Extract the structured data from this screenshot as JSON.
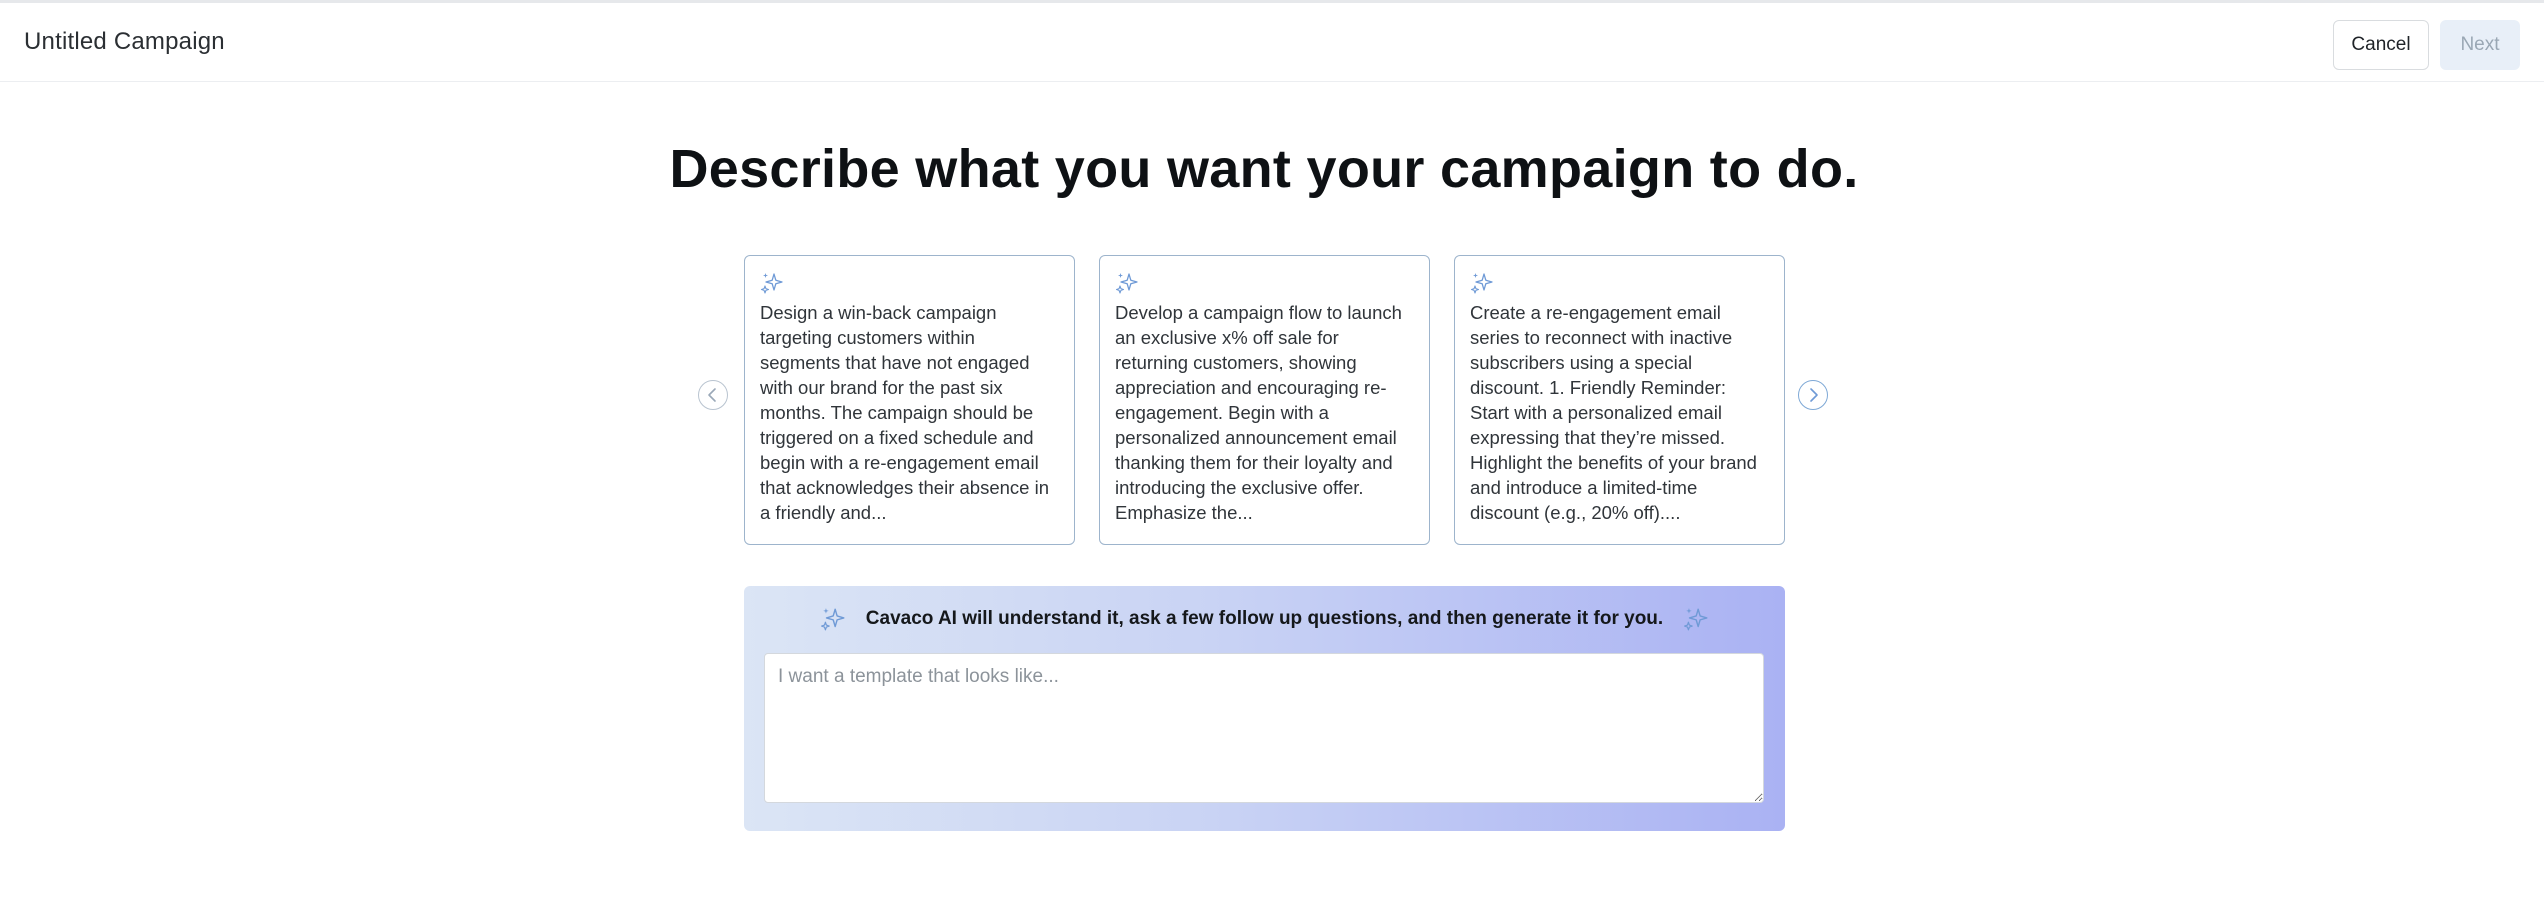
{
  "header": {
    "title": "Untitled Campaign",
    "cancel_label": "Cancel",
    "next_label": "Next"
  },
  "main": {
    "headline": "Describe what you want your campaign to do.",
    "suggestions": [
      {
        "text": "Design a win-back campaign targeting customers within segments that have not engaged with our brand for the past six months. The campaign should be triggered on a fixed schedule and begin with a re-engagement email that acknowledges their absence in a friendly and..."
      },
      {
        "text": "Develop a campaign flow to launch an exclusive x% off sale for returning customers, showing appreciation and encouraging re-engagement. Begin with a personalized announcement email thanking them for their loyalty and introducing the exclusive offer. Emphasize the..."
      },
      {
        "text": "Create a re-engagement email series to reconnect with inactive subscribers using a special discount. 1. Friendly Reminder: Start with a personalized email expressing that they’re missed. Highlight the benefits of your brand and introduce a limited-time discount (e.g., 20% off)...."
      }
    ],
    "ai_banner": "Cavaco AI will understand it, ask a few follow up questions, and then generate it for you.",
    "prompt": {
      "value": "",
      "placeholder": "I want a template that looks like..."
    }
  },
  "icons": {
    "sparkle": "sparkle-icon",
    "prev": "chevron-left-icon",
    "next": "chevron-right-icon"
  },
  "colors": {
    "sparkle": "#6f9ad6",
    "card_border": "#9db4cc",
    "gradient_start": "#dbe5f5",
    "gradient_end": "#aab2f3",
    "next_disabled_bg": "#e8eff8"
  }
}
